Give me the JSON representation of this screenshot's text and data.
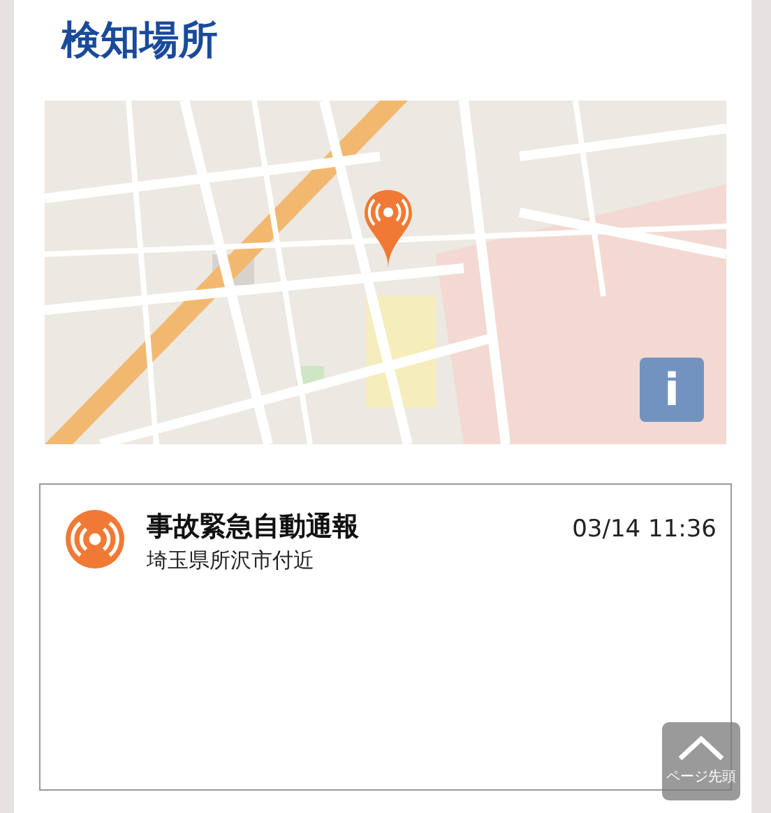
{
  "section_title": "検知場所",
  "map": {
    "kind": "picture",
    "info_button": "i"
  },
  "alert": {
    "title": "事故緊急自動通報",
    "location": "埼玉県所沢市付近",
    "time": "03/14 11:36"
  },
  "page_top_button": "ページ先頭"
}
